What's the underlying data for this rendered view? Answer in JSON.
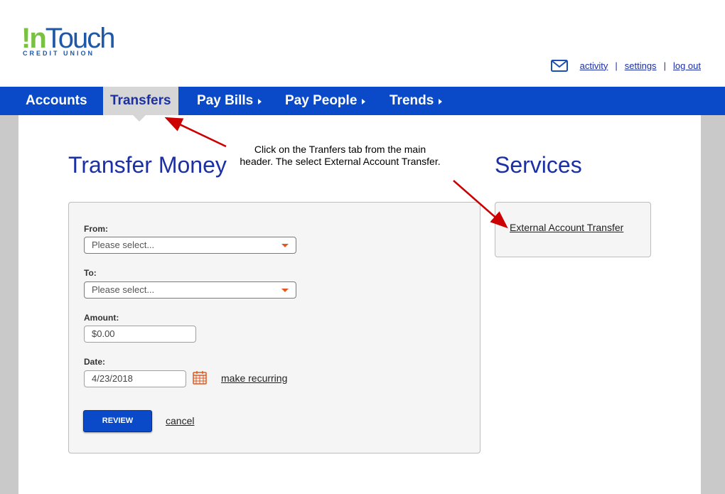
{
  "brand": {
    "logo_in": "!n",
    "logo_touch": "Touch",
    "logo_sub": "CREDIT UNION",
    "accent_green": "#7ac143",
    "brand_blue": "#1e58a7"
  },
  "util_nav": {
    "mail_icon": "envelope-icon",
    "activity": "activity",
    "settings": "settings",
    "logout": "log out",
    "separator": "|"
  },
  "nav": {
    "color": "#0a49c8",
    "items": [
      {
        "label": "Accounts",
        "has_caret": false,
        "active": false
      },
      {
        "label": "Transfers",
        "has_caret": false,
        "active": true
      },
      {
        "label": "Pay Bills",
        "has_caret": true,
        "active": false
      },
      {
        "label": "Pay People",
        "has_caret": true,
        "active": false
      },
      {
        "label": "Trends",
        "has_caret": true,
        "active": false
      }
    ]
  },
  "transfer": {
    "title": "Transfer Money",
    "from_label": "From:",
    "from_value": "Please select...",
    "to_label": "To:",
    "to_value": "Please select...",
    "amount_label": "Amount:",
    "amount_value": "$0.00",
    "date_label": "Date:",
    "date_value": "4/23/2018",
    "calendar_icon": "calendar-icon",
    "recurring_link": "make recurring",
    "review_button": "REVIEW",
    "cancel_link": "cancel"
  },
  "services": {
    "title": "Services",
    "external_link": "External Account Transfer"
  },
  "annotation": {
    "text": "Click on the Tranfers tab from the main header.  The select External Account Transfer.",
    "arrow_color": "#cc0000"
  }
}
